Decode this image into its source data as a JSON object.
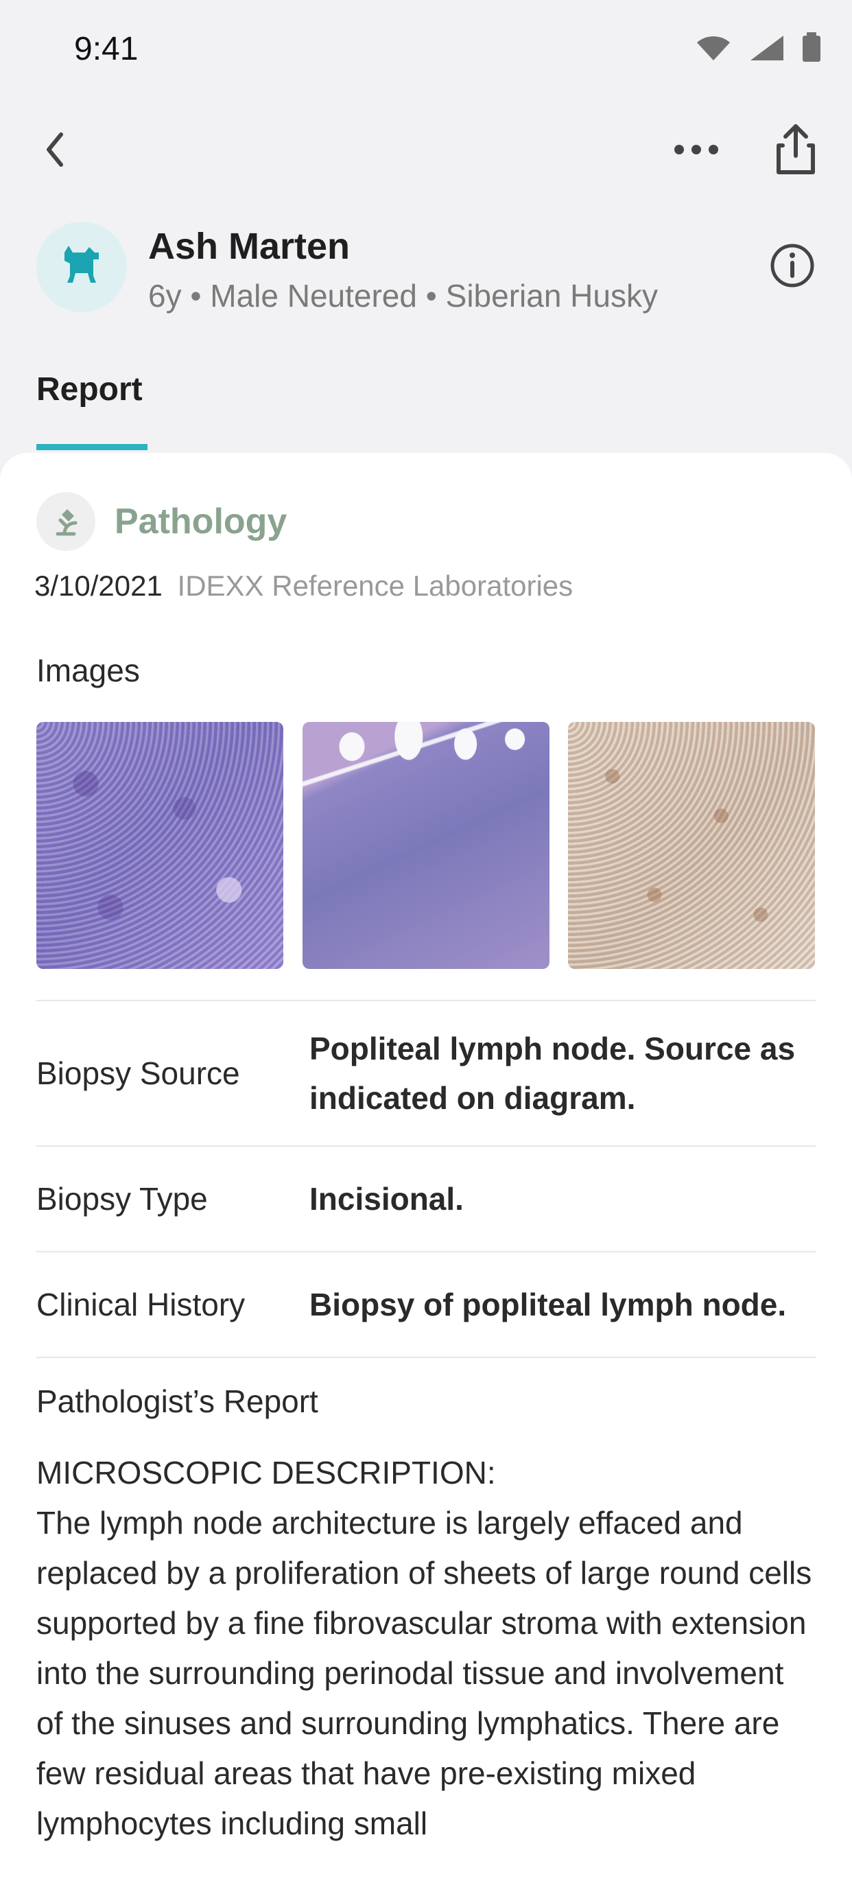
{
  "status_bar": {
    "time": "9:41"
  },
  "header": {
    "back_icon": "chevron-left-icon",
    "more_icon": "more-horizontal-icon",
    "share_icon": "share-icon"
  },
  "patient": {
    "name": "Ash Marten",
    "details": "6y • Male Neutered • Siberian Husky",
    "avatar_icon": "dog-icon",
    "info_icon": "info-icon"
  },
  "tabs": [
    {
      "label": "Report",
      "selected": true
    }
  ],
  "report": {
    "section_title": "Pathology",
    "section_icon": "microscope-icon",
    "date": "3/10/2021",
    "lab": "IDEXX Reference Laboratories",
    "images_label": "Images",
    "images": [
      "image-1",
      "image-2",
      "image-3"
    ],
    "details": [
      {
        "label": "Biopsy Source",
        "value": "Popliteal lymph node. Source as indicated on diagram."
      },
      {
        "label": "Biopsy Type",
        "value": "Incisional."
      },
      {
        "label": "Clinical History",
        "value": "Biopsy of popliteal lymph node."
      }
    ],
    "pathologist_report_label": "Pathologist’s Report",
    "pathologist_report_text": "MICROSCOPIC DESCRIPTION:\nThe lymph node architecture is largely effaced and replaced by a proliferation of sheets of large round cells supported by a fine fibrovascular stroma with extension into the surrounding perinodal tissue and involvement of the sinuses and surrounding lymphatics. There are few residual areas that have pre-existing mixed lymphocytes including small"
  },
  "colors": {
    "accent": "#2ab3bf",
    "section_title": "#8aa38f",
    "background": "#f2f2f4",
    "card": "#ffffff"
  }
}
